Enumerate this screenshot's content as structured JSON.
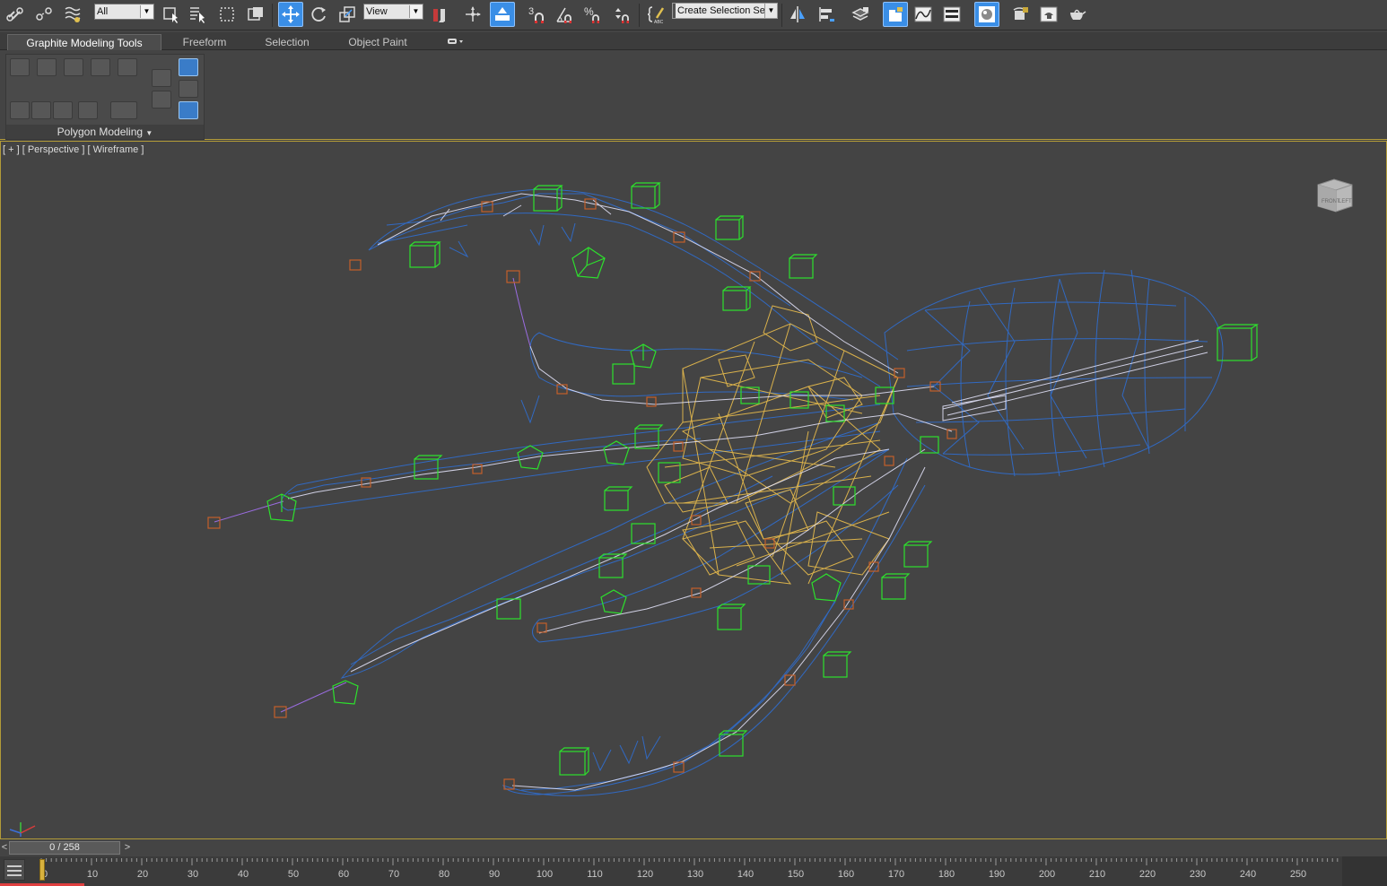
{
  "toolbar": {
    "selection_filter": "All",
    "ref_coord": "View",
    "snap_labels": {
      "snap3": "3",
      "angle": "",
      "percent": "%",
      "spinner": ""
    },
    "named_selection_placeholder": "Create Selection Se"
  },
  "ribbon": {
    "tabs": [
      "Graphite Modeling Tools",
      "Freeform",
      "Selection",
      "Object Paint"
    ],
    "active_tab": "Graphite Modeling Tools",
    "panel_label": "Polygon Modeling"
  },
  "viewport": {
    "label": "[ + ] [ Perspective ] [ Wireframe ]",
    "viewcube_faces": {
      "front": "FRONT",
      "left": "LEFT"
    },
    "colors": {
      "mesh": "#2f6ed0",
      "bones": "#e2b74c",
      "helpers": "#2de02d",
      "dummies": "#c4602a",
      "links": "#e8e8ff",
      "border": "#b29a38"
    }
  },
  "timeline": {
    "current": "0 / 258",
    "prev": "<",
    "next": ">",
    "ticks": [
      "0",
      "10",
      "20",
      "30",
      "40",
      "50",
      "60",
      "70",
      "80",
      "90",
      "100",
      "110",
      "120",
      "130",
      "140",
      "150",
      "160",
      "170",
      "180",
      "190",
      "200",
      "210",
      "220",
      "230",
      "240",
      "250"
    ]
  }
}
